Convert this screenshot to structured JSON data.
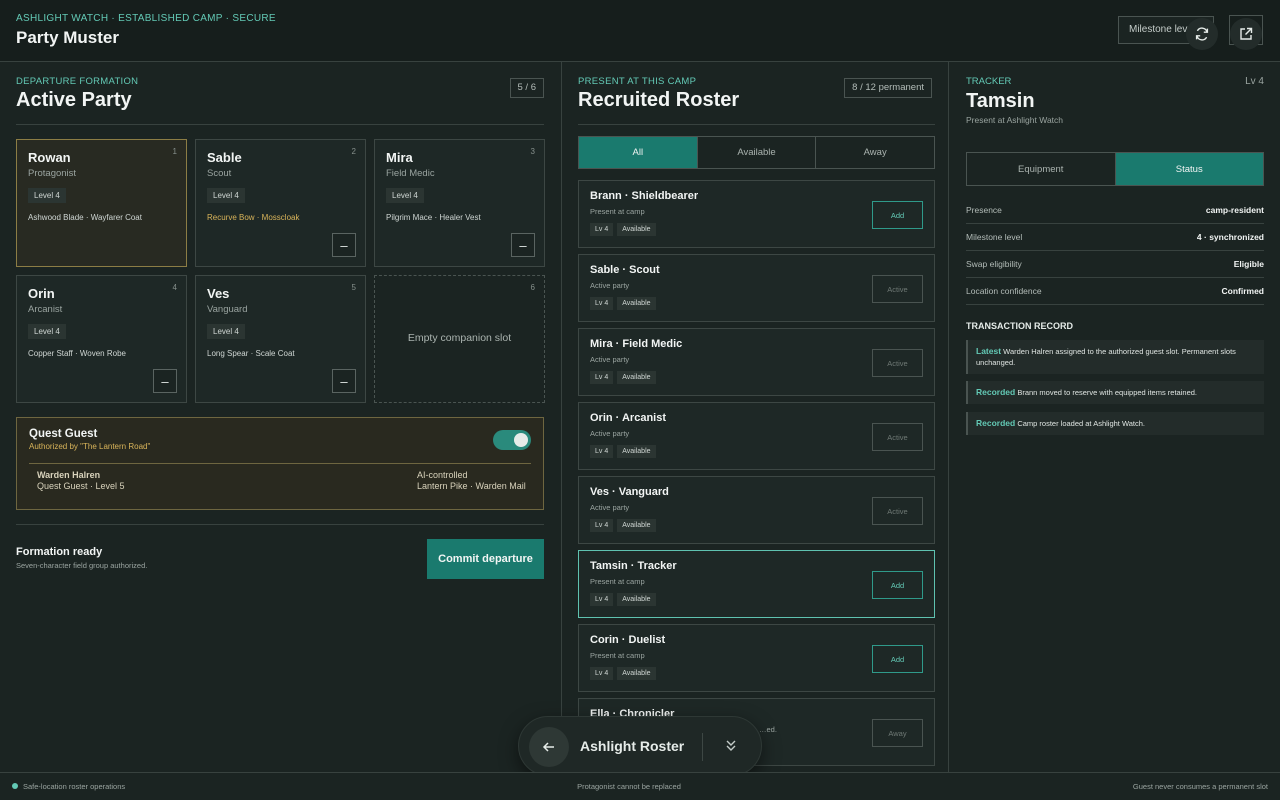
{
  "header": {
    "eyebrow": "ASHLIGHT WATCH · ESTABLISHED CAMP · SECURE",
    "title": "Party Muster",
    "milestone_button": "Milestone level",
    "refresh_icon": "refresh-icon",
    "external_icon": "external-link-icon"
  },
  "party": {
    "eyebrow": "DEPARTURE FORMATION",
    "title": "Active Party",
    "count": "5 / 6",
    "slots": [
      {
        "num": "1",
        "name": "Rowan",
        "role": "Protagonist",
        "level": "Level 4",
        "gear": "Ashwood Blade · Wayfarer Coat"
      },
      {
        "num": "2",
        "name": "Sable",
        "role": "Scout",
        "level": "Level 4",
        "gear": "Recurve Bow · Mosscloak",
        "remove": "–"
      },
      {
        "num": "3",
        "name": "Mira",
        "role": "Field Medic",
        "level": "Level 4",
        "gear": "Pilgrim Mace · Healer Vest",
        "remove": "–"
      },
      {
        "num": "4",
        "name": "Orin",
        "role": "Arcanist",
        "level": "Level 4",
        "gear": "Copper Staff · Woven Robe",
        "remove": "–"
      },
      {
        "num": "5",
        "name": "Ves",
        "role": "Vanguard",
        "level": "Level 4",
        "gear": "Long Spear · Scale Coat",
        "remove": "–"
      },
      {
        "num": "6",
        "empty_label": "Empty companion slot"
      }
    ],
    "guest": {
      "title": "Quest Guest",
      "authorized": "Authorized by \"The Lantern Road\"",
      "toggle_on": true,
      "name": "Warden Halren",
      "subtitle": "Quest Guest · Level 5",
      "control": "AI-controlled",
      "gear": "Lantern Pike · Warden Mail"
    },
    "ready_title": "Formation ready",
    "ready_sub": "Seven-character field group authorized.",
    "commit_label": "Commit departure"
  },
  "roster": {
    "eyebrow": "PRESENT AT THIS CAMP",
    "title": "Recruited Roster",
    "count": "8 / 12 permanent",
    "tabs": [
      "All",
      "Available",
      "Away"
    ],
    "active_tab": "All",
    "items": [
      {
        "name": "Brann · Shieldbearer",
        "status": "Present at camp",
        "lv": "Lv 4",
        "avail": "Available",
        "action": "Add"
      },
      {
        "name": "Sable · Scout",
        "status": "Active party",
        "lv": "Lv 4",
        "avail": "Available",
        "action": "Active"
      },
      {
        "name": "Mira · Field Medic",
        "status": "Active party",
        "lv": "Lv 4",
        "avail": "Available",
        "action": "Active"
      },
      {
        "name": "Orin · Arcanist",
        "status": "Active party",
        "lv": "Lv 4",
        "avail": "Available",
        "action": "Active"
      },
      {
        "name": "Ves · Vanguard",
        "status": "Active party",
        "lv": "Lv 4",
        "avail": "Available",
        "action": "Active"
      },
      {
        "name": "Tamsin · Tracker",
        "status": "Present at camp",
        "lv": "Lv 4",
        "avail": "Available",
        "action": "Add"
      },
      {
        "name": "Corin · Duelist",
        "status": "Present at camp",
        "lv": "Lv 4",
        "avail": "Available",
        "action": "Add"
      },
      {
        "name": "Ella · Chronicler",
        "status": "…ed.",
        "action": "Away"
      }
    ]
  },
  "detail": {
    "eyebrow": "TRACKER",
    "level": "Lv 4",
    "name": "Tamsin",
    "location": "Present at Ashlight Watch",
    "tabs": [
      "Equipment",
      "Status"
    ],
    "active_tab": "Status",
    "rows": [
      {
        "k": "Presence",
        "v": "camp-resident"
      },
      {
        "k": "Milestone level",
        "v": "4 · synchronized"
      },
      {
        "k": "Swap eligibility",
        "v": "Eligible"
      },
      {
        "k": "Location confidence",
        "v": "Confirmed"
      }
    ],
    "tx_heading": "TRANSACTION RECORD",
    "transactions": [
      {
        "tag": "Latest",
        "text": "Warden Halren assigned to the authorized guest slot. Permanent slots unchanged."
      },
      {
        "tag": "Recorded",
        "text": "Brann moved to reserve with equipped items retained."
      },
      {
        "tag": "Recorded",
        "text": "Camp roster loaded at Ashlight Watch."
      }
    ]
  },
  "dock": {
    "title": "Ashlight Roster",
    "back_icon": "arrow-left-icon",
    "expand_icon": "chevron-double-down-icon"
  },
  "footer": {
    "left": "Safe-location roster operations",
    "center": "Protagonist cannot be replaced",
    "right": "Guest never consumes a permanent slot"
  },
  "colors": {
    "accent": "#1a7a6e",
    "accent_text": "#63c9b5",
    "gold": "#d9b45a",
    "background": "#1b2422"
  }
}
